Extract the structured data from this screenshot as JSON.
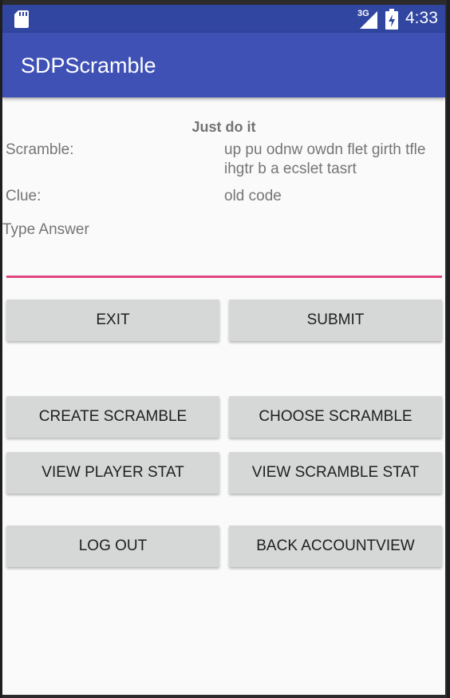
{
  "status_bar": {
    "network": "3G",
    "time": "4:33",
    "icons": [
      "sd-card-icon",
      "signal-icon",
      "battery-icon"
    ]
  },
  "app_bar": {
    "title": "SDPScramble"
  },
  "content": {
    "heading": "Just do it",
    "scramble_label": "Scramble:",
    "scramble_line1": "up pu odnw owdn flet girth tfle",
    "scramble_line2": "ihgtr b a ecslet tasrt",
    "clue_label": "Clue:",
    "clue_value": "old code",
    "answer_label": "Type Answer",
    "answer_value": ""
  },
  "buttons": {
    "exit": "EXIT",
    "submit": "SUBMIT",
    "create_scramble": "CREATE SCRAMBLE",
    "choose_scramble": "CHOOSE SCRAMBLE",
    "view_player_stat": "VIEW PLAYER STAT",
    "view_scramble_stat": "VIEW SCRAMBLE STAT",
    "log_out": "LOG OUT",
    "back_accountview": "BACK ACCOUNTVIEW"
  },
  "colors": {
    "status_bar": "#3146a0",
    "app_bar": "#3f51b5",
    "accent_underline": "#e04680",
    "button_bg": "#d6d7d7",
    "background": "#fafafa"
  }
}
